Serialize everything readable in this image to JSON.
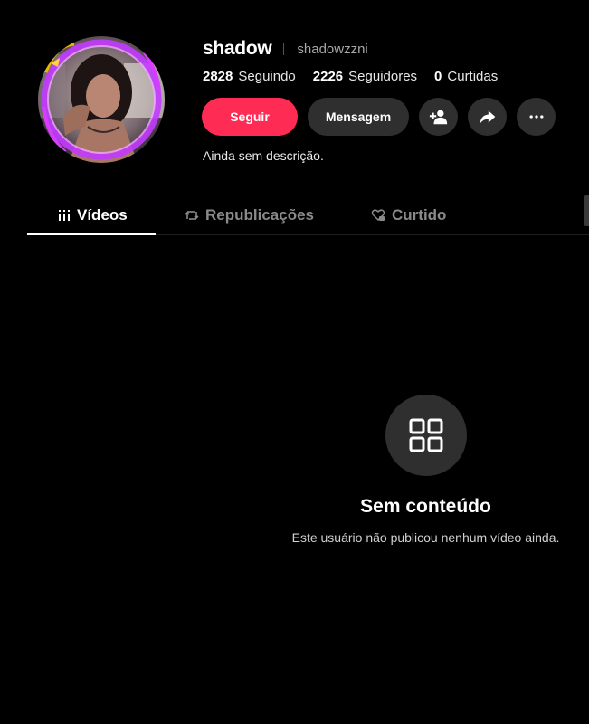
{
  "profile": {
    "username": "shadow",
    "handle": "shadowzzni",
    "bio": "Ainda sem descrição."
  },
  "stats": [
    {
      "number": "2828",
      "label": "Seguindo"
    },
    {
      "number": "2226",
      "label": "Seguidores"
    },
    {
      "number": "0",
      "label": "Curtidas"
    }
  ],
  "actions": {
    "follow_label": "Seguir",
    "message_label": "Mensagem",
    "add_friend_icon": "person-plus-icon",
    "share_icon": "share-arrow-icon",
    "more_icon": "more-dots-icon"
  },
  "tabs": [
    {
      "label": "Vídeos",
      "icon": "grid-bars-icon",
      "active": true
    },
    {
      "label": "Republicações",
      "icon": "repost-icon",
      "active": false
    },
    {
      "label": "Curtido",
      "icon": "heart-lock-icon",
      "active": false
    }
  ],
  "empty_state": {
    "icon": "grid-icon",
    "title": "Sem conteúdo",
    "subtitle": "Este usuário não publicou nenhum vídeo ainda."
  },
  "colors": {
    "background": "#000000",
    "accent": "#fe2c55",
    "button_secondary": "#2f2f2f",
    "muted_text": "#8a8a8a",
    "avatar_ring": "#c23bff"
  }
}
